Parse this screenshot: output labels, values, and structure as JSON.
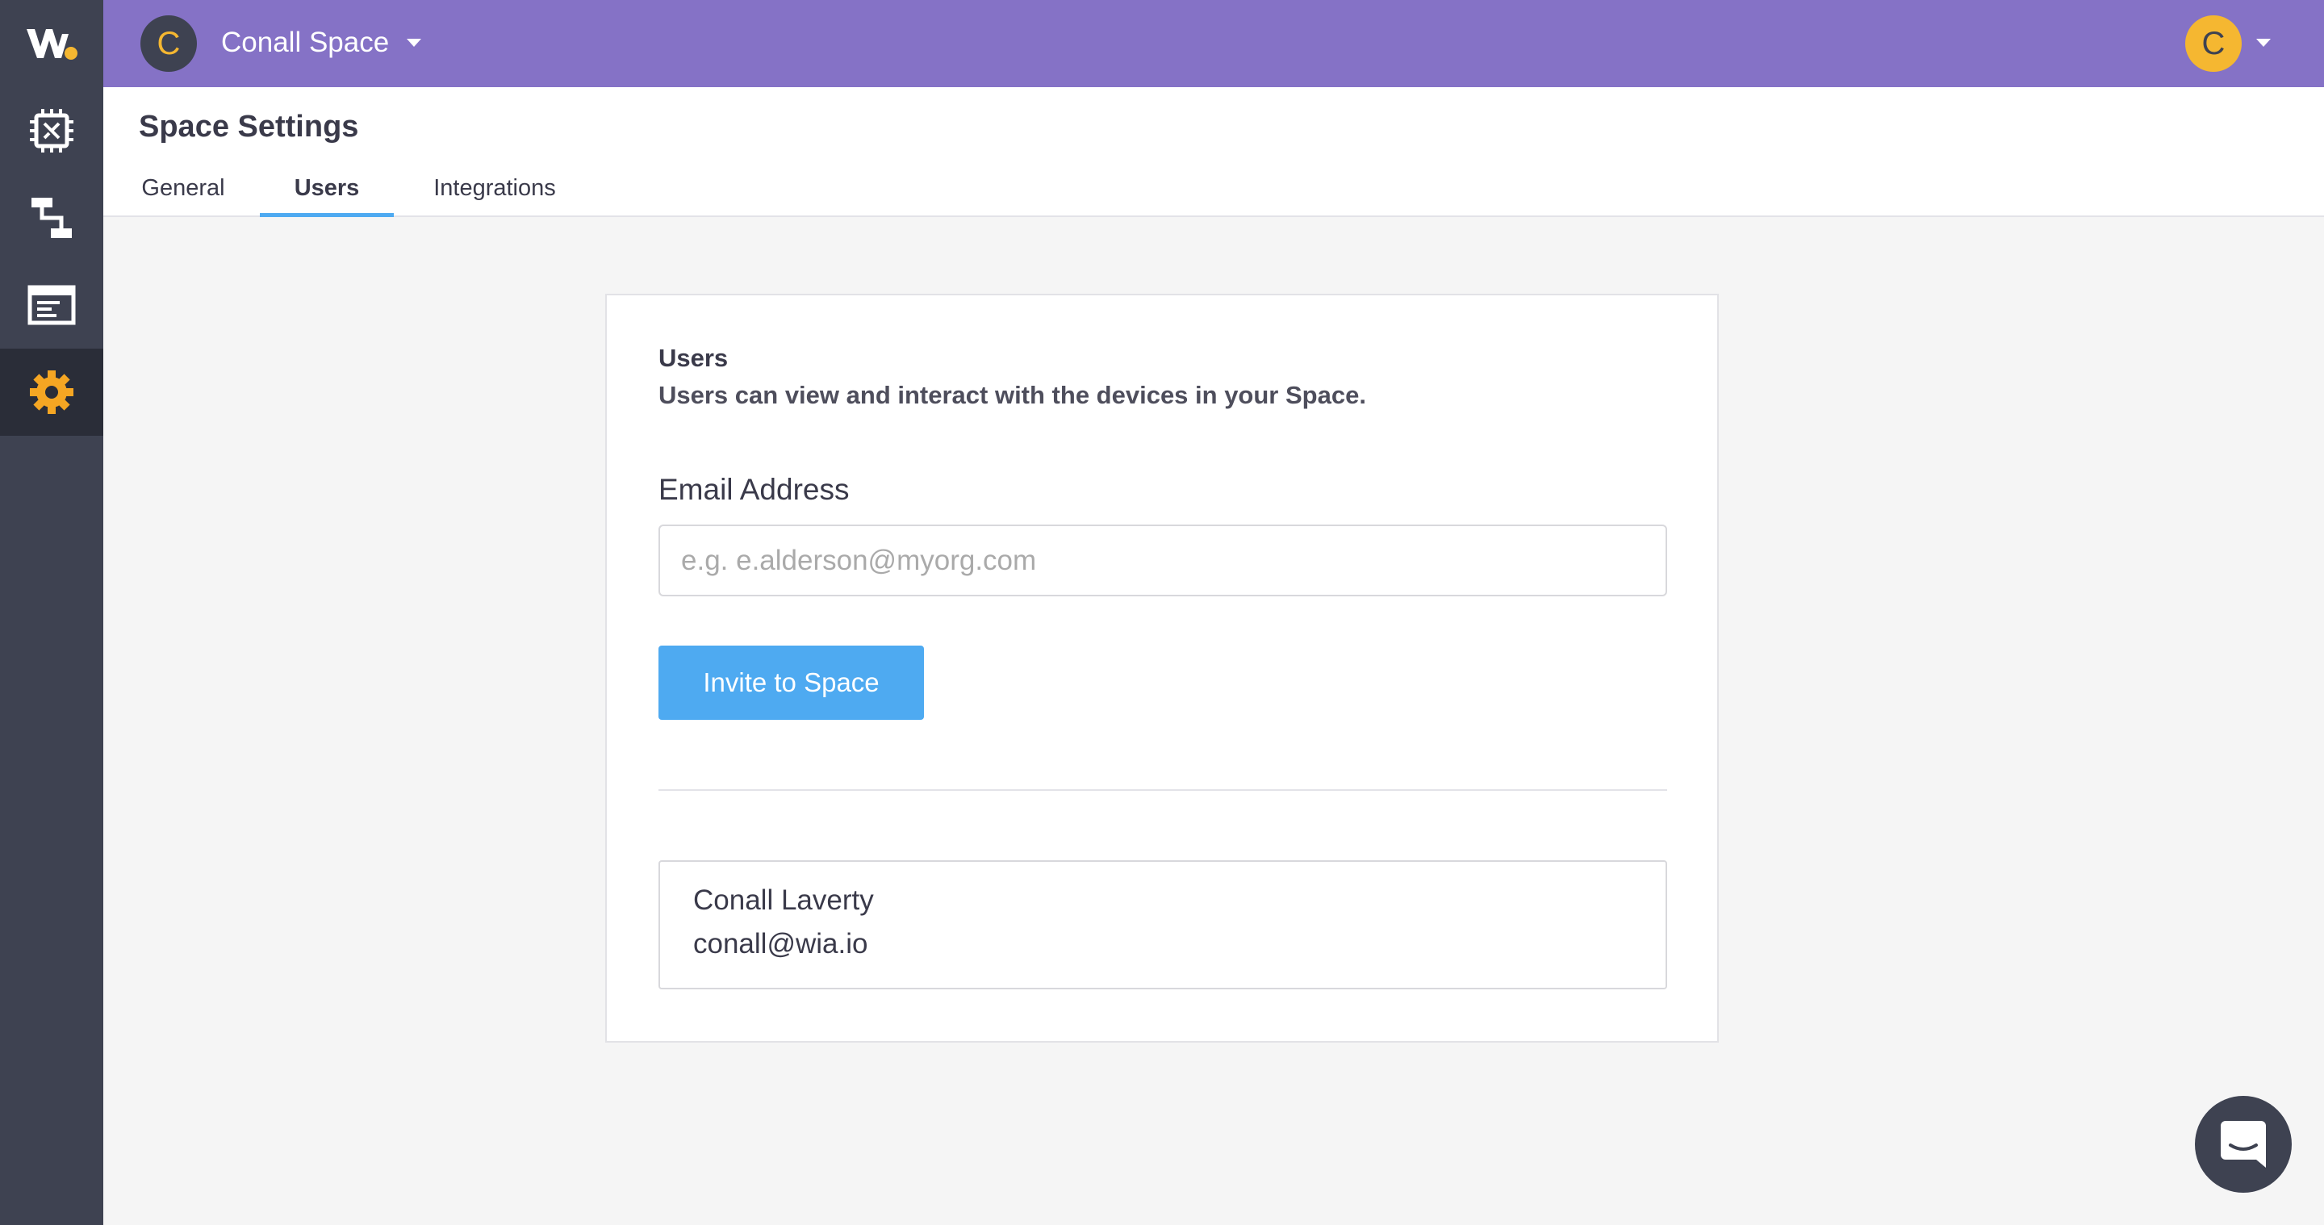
{
  "brand": {
    "logo_alt": "Wia",
    "accent": "#8572c6",
    "sidebar_bg": "#3e4251",
    "button_color": "#4eaaf1",
    "active_nav_icon_color": "#f5a623"
  },
  "sidebar": {
    "items": [
      {
        "icon": "chip-icon",
        "label": "Devices",
        "active": false
      },
      {
        "icon": "flow-icon",
        "label": "Flows",
        "active": false
      },
      {
        "icon": "dashboard-icon",
        "label": "Dashboards",
        "active": false
      },
      {
        "icon": "gear-icon",
        "label": "Settings",
        "active": true
      }
    ]
  },
  "topbar": {
    "space_initial": "C",
    "space_name": "Conall Space",
    "user_initial": "C"
  },
  "header": {
    "title": "Space Settings",
    "tabs": [
      {
        "label": "General",
        "active": false
      },
      {
        "label": "Users",
        "active": true
      },
      {
        "label": "Integrations",
        "active": false
      }
    ]
  },
  "users_card": {
    "heading": "Users",
    "description": "Users can view and interact with the devices in your Space.",
    "email_label": "Email Address",
    "email_value": "",
    "email_placeholder": "e.g. e.alderson@myorg.com",
    "invite_button": "Invite to Space",
    "members": [
      {
        "name": "Conall Laverty",
        "email": "conall@wia.io"
      }
    ]
  },
  "chat": {
    "icon": "chat-bubble-icon"
  }
}
